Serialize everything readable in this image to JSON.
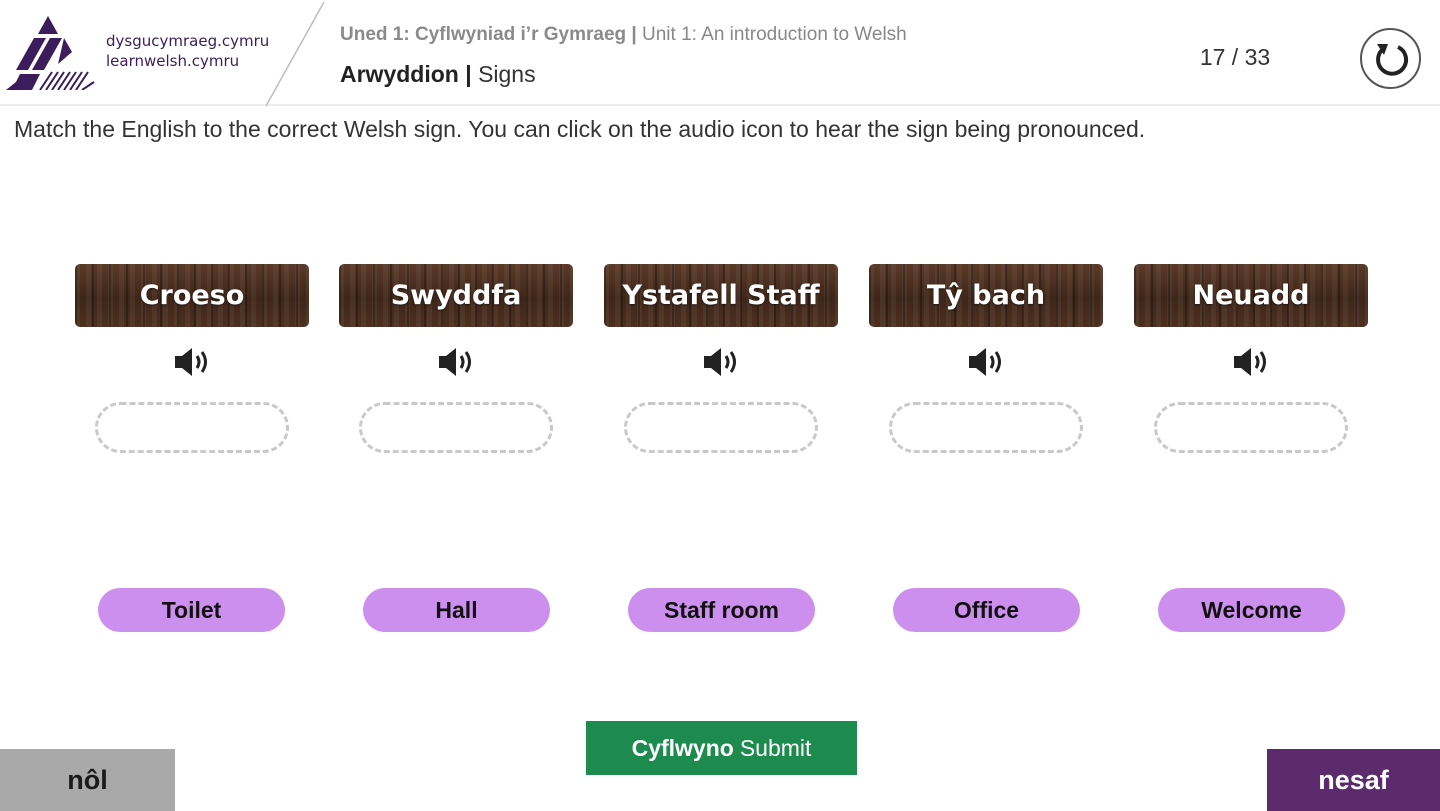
{
  "header": {
    "site_name_cy": "dysgucymraeg.cymru",
    "site_name_en": "learnwelsh.cymru",
    "unit_cy": "Uned 1: Cyflwyniad i’r Gymraeg",
    "unit_separator": " | ",
    "unit_en": "Unit 1: An introduction to Welsh",
    "topic_cy": "Arwyddion",
    "topic_separator": " | ",
    "topic_en": "Signs",
    "page_counter": "17 / 33",
    "restart_icon": "restart-icon"
  },
  "instructions": "Match the English to the correct Welsh sign. You can click on the audio icon to hear the sign being pronounced.",
  "signs": [
    {
      "label": "Croeso",
      "audio_icon": "speaker-icon"
    },
    {
      "label": "Swyddfa",
      "audio_icon": "speaker-icon"
    },
    {
      "label": "Ystafell Staff",
      "audio_icon": "speaker-icon"
    },
    {
      "label": "Tŷ bach",
      "audio_icon": "speaker-icon"
    },
    {
      "label": "Neuadd",
      "audio_icon": "speaker-icon"
    }
  ],
  "answers": [
    "Toilet",
    "Hall",
    "Staff room",
    "Office",
    "Welcome"
  ],
  "submit": {
    "label_cy": "Cyflwyno",
    "label_en": "Submit"
  },
  "nav": {
    "back_label": "nôl",
    "next_label": "nesaf"
  },
  "colors": {
    "brand_purple": "#5b2b6e",
    "answer_pill": "#cc8fee",
    "submit_green": "#1d8a4e",
    "back_grey": "#a9a9a9",
    "sign_wood": "#4a2e1f"
  }
}
